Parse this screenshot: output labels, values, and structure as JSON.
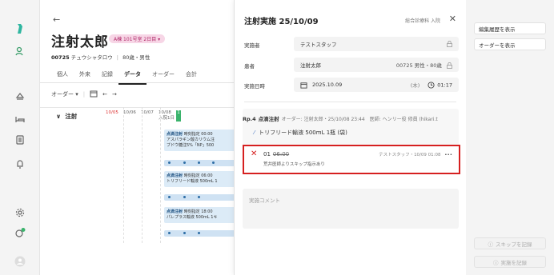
{
  "patient": {
    "name": "注射太郎",
    "ward_badge": "A棟 101号室 2日目",
    "id": "00725",
    "kana": "チュウシャタロウ",
    "age_sex": "80歳・男性"
  },
  "tabs": [
    "個人",
    "外来",
    "記録",
    "データ",
    "オーダー",
    "会計"
  ],
  "active_tab": "データ",
  "toolbar": {
    "filter_label": "オーダー"
  },
  "grid": {
    "row_label": "注射",
    "dates": [
      "10/05",
      "10/06",
      "10/07",
      "10/08\n入院1日",
      "1"
    ]
  },
  "cards": [
    {
      "title": "点滴注射",
      "time": "時刻指定 00:00",
      "l1": "アスパラギン酸カリウム注",
      "l2": "ブドウ糖注5%「NP」500"
    },
    {
      "title": "点滴注射",
      "time": "時刻指定 06:00",
      "l1": "トリフリード輸液 500mL 1",
      "l2": ""
    },
    {
      "title": "点滴注射",
      "time": "時刻指定 18:00",
      "l1": "パレプラス輸液 500mL 1キ",
      "l2": ""
    }
  ],
  "modal": {
    "title": "注射実施 25/10/09",
    "dept": "総合診療科 入院",
    "close": "✕",
    "fields": {
      "performer_label": "実施者",
      "performer_value": "テストスタッフ",
      "patient_label": "患者",
      "patient_value": "注射太郎",
      "patient_right": "00725 男性・80歳",
      "datetime_label": "実施日時",
      "date_value": "2025.10.09",
      "weekday": "(木)",
      "time_value": "01:17"
    },
    "rx": {
      "number": "Rp.4",
      "kind": "点滴注射",
      "meta": "オーダー: 注射太郎・25/10/08 23:44　医師: ヘンリー役 修員 (hikari.t",
      "drug": "トリフリード輸液 500mL 1瓶 (袋)"
    },
    "skip": {
      "index": "01",
      "time": "06:00",
      "meta": "テストスタッフ・10/09 01:08",
      "menu": "•••",
      "note": "荒井医師よりスキップ指示あり"
    },
    "comment_placeholder": "実施コメント"
  },
  "right_panel": {
    "edit_history": "編集履歴を表示",
    "show_order": "オーダーを表示",
    "record_skip": "スキップを記録",
    "record_done": "実施を記録"
  }
}
